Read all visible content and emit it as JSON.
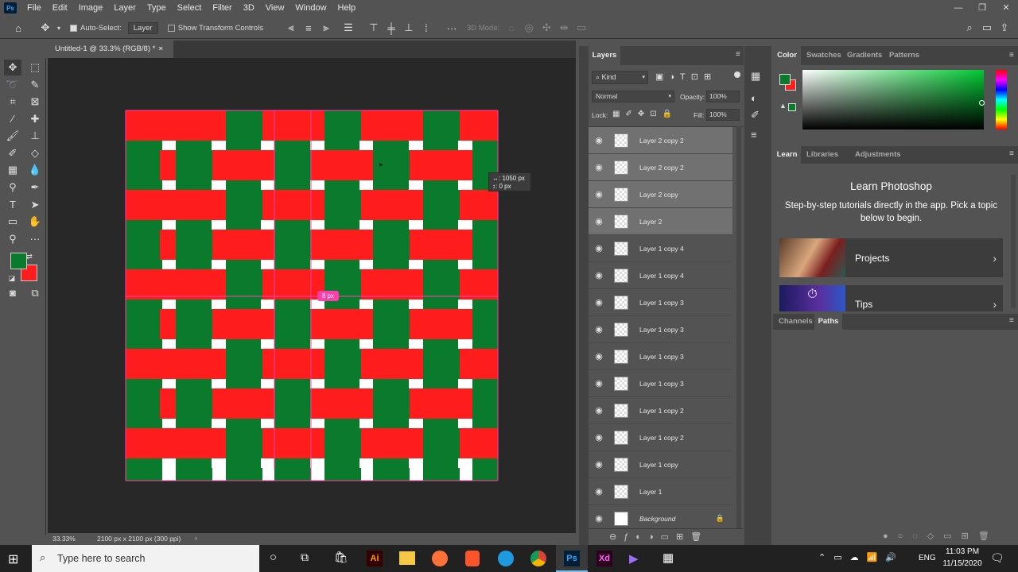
{
  "menubar": {
    "items": [
      "File",
      "Edit",
      "Image",
      "Layer",
      "Type",
      "Select",
      "Filter",
      "3D",
      "View",
      "Window",
      "Help"
    ],
    "logo": "Ps"
  },
  "window_controls": {
    "minimize": "—",
    "maximize": "❐",
    "close": "✕"
  },
  "options": {
    "auto_select_label": "Auto-Select:",
    "auto_select_value": "Layer",
    "transform_label": "Show Transform Controls",
    "mode_label": "3D Mode:"
  },
  "document": {
    "tab_title": "Untitled-1 @ 33.3% (RGB/8) *",
    "tab_close": "×",
    "zoom": "33.33%",
    "doc_info": "2100 px x 2100 px (300 ppi)",
    "status_arrow": "›"
  },
  "canvas": {
    "tooltip_x": "↔: 1050 px",
    "tooltip_y": "↕:      0 px",
    "guide_badge": "8 px",
    "colors": {
      "red": "#ff1c1c",
      "green": "#0a7a2c",
      "white": "#ffffff",
      "guide": "#ff3fa9"
    }
  },
  "layers_panel": {
    "tab": "Layers",
    "kind": "Kind",
    "blend": "Normal",
    "opacity_label": "Opacity:",
    "opacity": "100%",
    "lock_label": "Lock:",
    "fill_label": "Fill:",
    "fill": "100%",
    "layers": [
      {
        "name": "Layer 2 copy 2",
        "selected": true
      },
      {
        "name": "Layer 2 copy 2",
        "selected": true
      },
      {
        "name": "Layer 2 copy",
        "selected": true
      },
      {
        "name": "Layer 2",
        "selected": true
      },
      {
        "name": "Layer 1 copy 4",
        "selected": false
      },
      {
        "name": "Layer 1 copy 4",
        "selected": false
      },
      {
        "name": "Layer 1 copy 3",
        "selected": false
      },
      {
        "name": "Layer 1 copy 3",
        "selected": false
      },
      {
        "name": "Layer 1 copy 3",
        "selected": false
      },
      {
        "name": "Layer 1 copy 3",
        "selected": false
      },
      {
        "name": "Layer 1 copy 2",
        "selected": false
      },
      {
        "name": "Layer 1 copy 2",
        "selected": false
      },
      {
        "name": "Layer 1 copy",
        "selected": false
      },
      {
        "name": "Layer 1",
        "selected": false
      },
      {
        "name": "Background",
        "selected": false
      }
    ]
  },
  "color_panel": {
    "tabs": [
      "Color",
      "Swatches",
      "Gradients",
      "Patterns"
    ],
    "foreground": "#0a7a2c",
    "background": "#ff1c1c"
  },
  "learn_panel": {
    "tabs": [
      "Learn",
      "Libraries",
      "Adjustments"
    ],
    "title": "Learn Photoshop",
    "desc": "Step-by-step tutorials directly in the app. Pick a topic below to begin.",
    "cards": [
      "Projects",
      "Tips"
    ]
  },
  "paths_panel": {
    "tabs": [
      "Channels",
      "Paths"
    ]
  },
  "taskbar": {
    "search_placeholder": "Type here to search",
    "lang": "ENG",
    "time": "11:03 PM",
    "date": "11/15/2020",
    "apps": [
      "Ai",
      "Ps",
      "Xd"
    ]
  }
}
